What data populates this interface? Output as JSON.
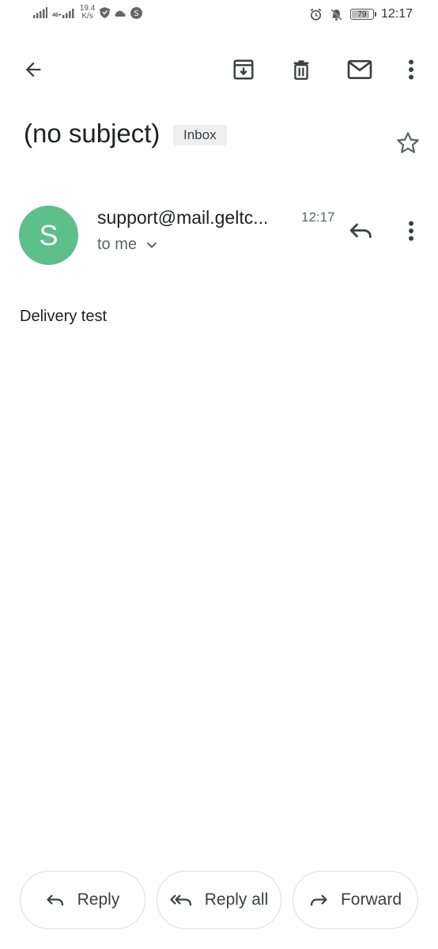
{
  "status_bar": {
    "net_speed_value": "19.4",
    "net_speed_unit": "K/s",
    "signal_tech": "46+",
    "battery_level": "79",
    "time": "12:17"
  },
  "toolbar": {
    "back_icon": "arrow-back-icon",
    "archive_icon": "archive-icon",
    "delete_icon": "trash-icon",
    "mark_unread_icon": "mail-icon",
    "more_icon": "more-vert-icon"
  },
  "email": {
    "subject": "(no subject)",
    "label": "Inbox",
    "starred": false,
    "sender": {
      "avatar_letter": "S",
      "avatar_color": "#5dbf8a",
      "name": "support@mail.geltc...",
      "time": "12:17",
      "recipient": "to me"
    },
    "body": "Delivery test"
  },
  "actions": {
    "reply": "Reply",
    "reply_all": "Reply all",
    "forward": "Forward"
  },
  "colors": {
    "icon": "#3c4043",
    "avatar": "#5dbf8a",
    "chip_bg": "#eeeeee",
    "button_border": "#dadce0"
  }
}
